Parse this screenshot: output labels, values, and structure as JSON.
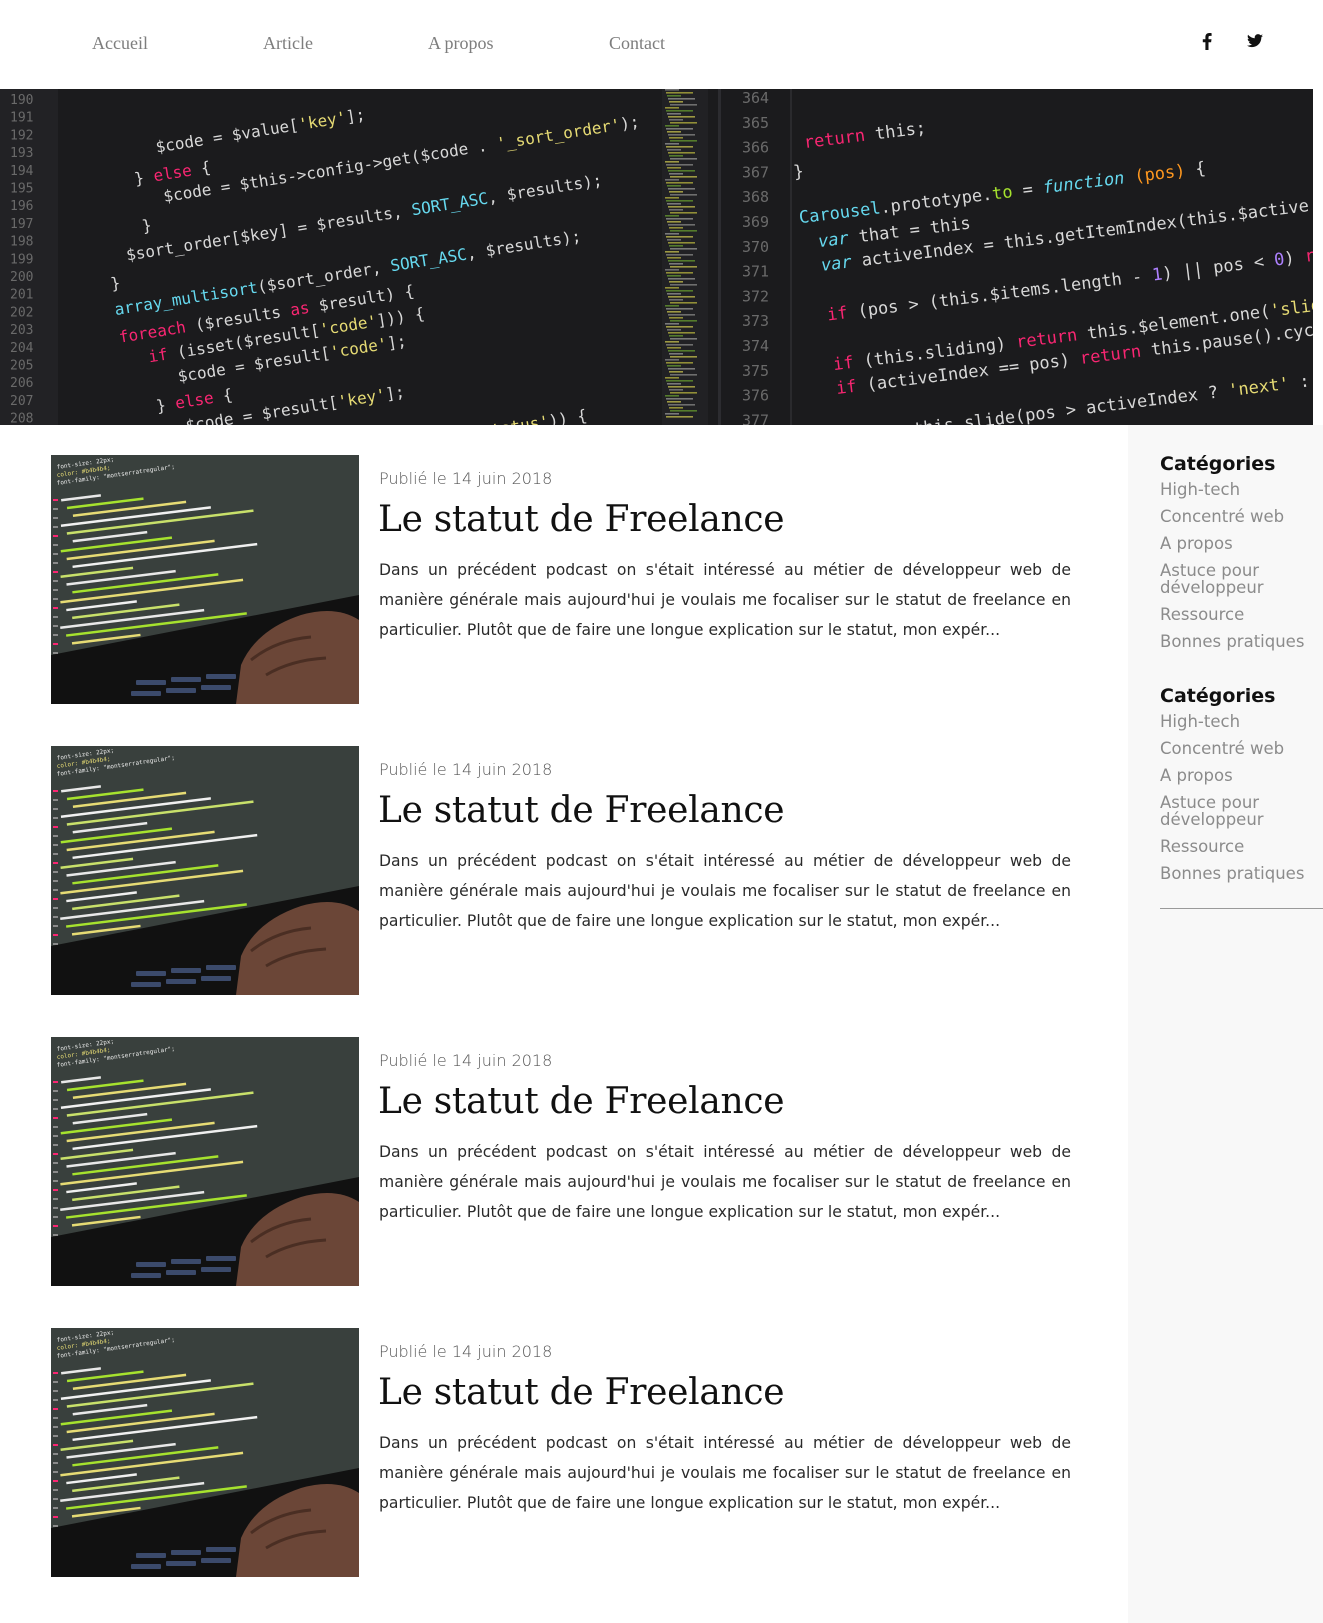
{
  "nav": {
    "links": [
      "Accueil",
      "Article",
      "A propos",
      "Contact"
    ],
    "social": [
      "facebook-icon",
      "twitter-icon"
    ]
  },
  "hero": {
    "left_lines": [
      "190",
      "191",
      "192",
      "193",
      "194",
      "195",
      "196",
      "197",
      "198",
      "199",
      "200",
      "201",
      "202",
      "203",
      "204",
      "205",
      "206",
      "207",
      "208"
    ],
    "right_lines": [
      "364",
      "365",
      "366",
      "367",
      "368",
      "369",
      "370",
      "371",
      "372",
      "373",
      "374",
      "375",
      "376",
      "377"
    ]
  },
  "posts": [
    {
      "date": "Publié le 14 juin 2018",
      "title": "Le statut de Freelance",
      "excerpt": "Dans un précédent podcast on s'était intéressé au métier de développeur web de manière générale mais aujourd'hui je voulais me focaliser sur le statut de freelance en particulier. Plutôt que de faire une longue explication sur le statut, mon expér..."
    },
    {
      "date": "Publié le 14 juin 2018",
      "title": "Le statut de Freelance",
      "excerpt": "Dans un précédent podcast on s'était intéressé au métier de développeur web de manière générale mais aujourd'hui je voulais me focaliser sur le statut de freelance en particulier. Plutôt que de faire une longue explication sur le statut, mon expér..."
    },
    {
      "date": "Publié le 14 juin 2018",
      "title": "Le statut de Freelance",
      "excerpt": "Dans un précédent podcast on s'était intéressé au métier de développeur web de manière générale mais aujourd'hui je voulais me focaliser sur le statut de freelance en particulier. Plutôt que de faire une longue explication sur le statut, mon expér..."
    },
    {
      "date": "Publié le 14 juin 2018",
      "title": "Le statut de Freelance",
      "excerpt": "Dans un précédent podcast on s'était intéressé au métier de développeur web de manière générale mais aujourd'hui je voulais me focaliser sur le statut de freelance en particulier. Plutôt que de faire une longue explication sur le statut, mon expér..."
    }
  ],
  "sidebar": {
    "blocks": [
      {
        "title": "Catégories",
        "items": [
          "High-tech",
          "Concentré web",
          "A propos",
          "Astuce pour développeur",
          "Ressource",
          "Bonnes pratiques"
        ]
      },
      {
        "title": "Catégories",
        "items": [
          "High-tech",
          "Concentré web",
          "A propos",
          "Astuce pour développeur",
          "Ressource",
          "Bonnes pratiques"
        ]
      }
    ]
  },
  "colors": {
    "nav_text": "#7d7d7d",
    "hero_bg": "#1d1d1f",
    "sidebar_bg": "#f8f8f8",
    "category_text": "#8b8b8b"
  }
}
